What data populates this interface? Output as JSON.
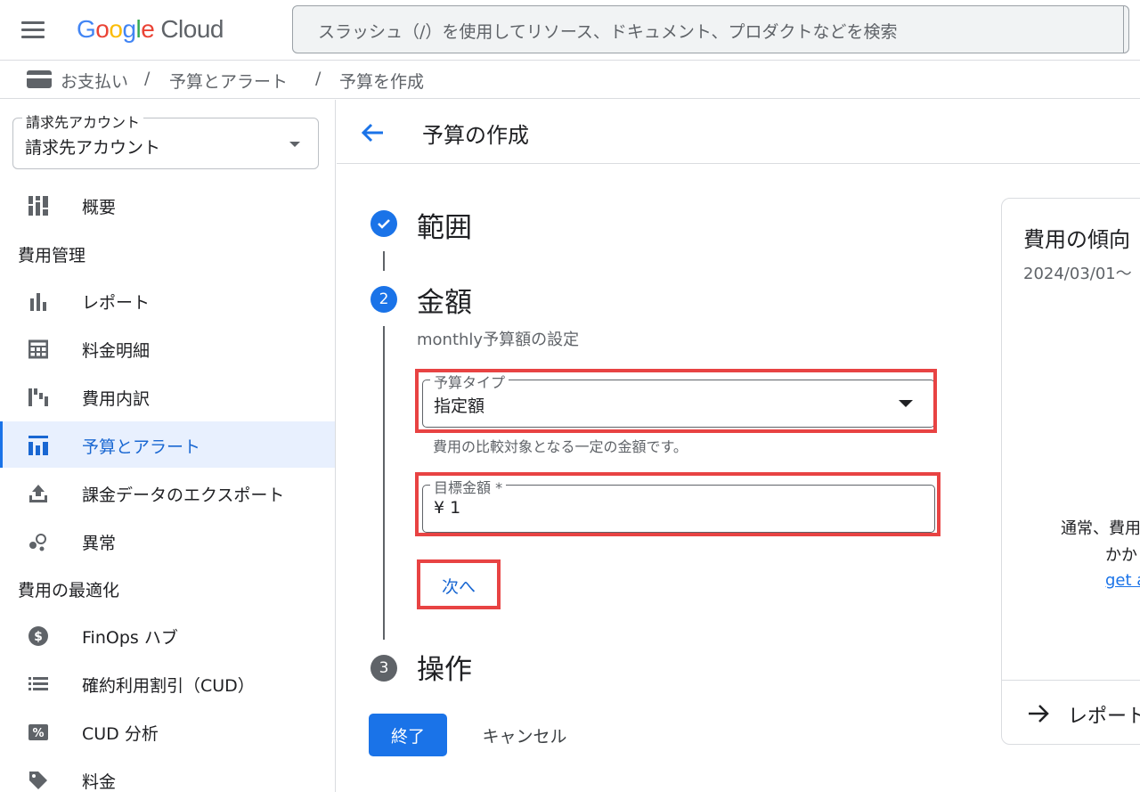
{
  "topbar": {
    "logo_letters": [
      "G",
      "o",
      "o",
      "g",
      "l",
      "e"
    ],
    "logo_product": "Cloud",
    "search_placeholder": "スラッシュ（/）を使用してリソース、ドキュメント、プロダクトなどを検索"
  },
  "breadcrumb": {
    "items": [
      "お支払い",
      "予算とアラート",
      "予算を作成"
    ],
    "separator": "/"
  },
  "sidebar": {
    "account_label": "請求先アカウント",
    "account_value": "請求先アカウント",
    "overview": "概要",
    "section_cost": "費用管理",
    "items_cost": [
      {
        "label": "レポート",
        "icon": "bar-chart-icon"
      },
      {
        "label": "料金明細",
        "icon": "table-icon"
      },
      {
        "label": "費用内訳",
        "icon": "waterfall-chart-icon"
      },
      {
        "label": "予算とアラート",
        "icon": "budget-icon",
        "active": true
      },
      {
        "label": "課金データのエクスポート",
        "icon": "export-icon"
      },
      {
        "label": "異常",
        "icon": "anomaly-icon"
      }
    ],
    "section_opt": "費用の最適化",
    "items_opt": [
      {
        "label": "FinOps ハブ",
        "icon": "dollar-icon"
      },
      {
        "label": "確約利用割引（CUD）",
        "icon": "list-icon"
      },
      {
        "label": "CUD 分析",
        "icon": "percent-icon"
      },
      {
        "label": "料金",
        "icon": "tag-icon"
      }
    ]
  },
  "main": {
    "title": "予算の作成",
    "steps": [
      {
        "number": "✓",
        "title": "範囲",
        "state": "done"
      },
      {
        "number": "2",
        "title": "金額",
        "state": "active"
      },
      {
        "number": "3",
        "title": "操作",
        "state": "pending"
      }
    ],
    "amount_subtitle": "monthly予算額の設定",
    "budget_type": {
      "label": "予算タイプ",
      "value": "指定額",
      "helper": "費用の比較対象となる一定の金額です。"
    },
    "target_amount": {
      "label": "目標金額 *",
      "currency": "¥",
      "value": "1"
    },
    "next_label": "次へ",
    "finish_label": "終了",
    "cancel_label": "キャンセル"
  },
  "card": {
    "title": "費用の傾向",
    "date": "2024/03/01〜",
    "msg_line1": "通常、費用",
    "msg_line2": "かか",
    "link": "get a",
    "footer_label": "レポート"
  },
  "colors": {
    "accent": "#1a73e8",
    "highlight": "#e84343",
    "active_bg": "#e8f0fe"
  }
}
